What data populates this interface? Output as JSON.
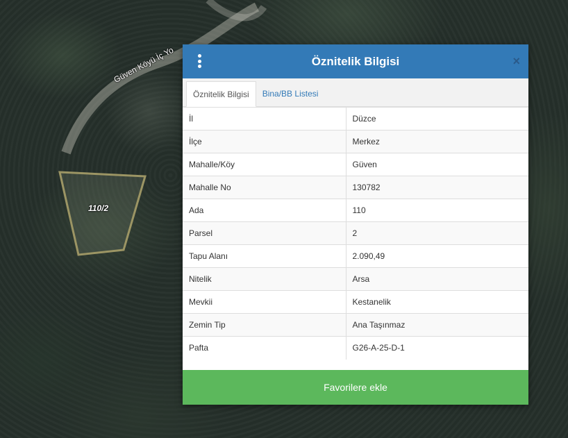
{
  "map": {
    "road_label": "Güven Köyü İç Yo",
    "parcel_label": "110/2"
  },
  "dialog": {
    "title": "Öznitelik Bilgisi",
    "menu_icon": "vertical-dots-icon",
    "close_label": "×",
    "tabs": [
      {
        "label": "Öznitelik Bilgisi",
        "active": true
      },
      {
        "label": "Bina/BB Listesi",
        "active": false
      }
    ],
    "rows": [
      {
        "key": "İl",
        "value": "Düzce"
      },
      {
        "key": "İlçe",
        "value": "Merkez"
      },
      {
        "key": "Mahalle/Köy",
        "value": "Güven"
      },
      {
        "key": "Mahalle No",
        "value": "130782"
      },
      {
        "key": "Ada",
        "value": "110"
      },
      {
        "key": "Parsel",
        "value": "2"
      },
      {
        "key": "Tapu Alanı",
        "value": "2.090,49"
      },
      {
        "key": "Nitelik",
        "value": "Arsa"
      },
      {
        "key": "Mevkii",
        "value": "Kestanelik"
      },
      {
        "key": "Zemin Tip",
        "value": "Ana Taşınmaz"
      },
      {
        "key": "Pafta",
        "value": "G26-A-25-D-1"
      }
    ],
    "favorite_button": "Favorilere ekle"
  },
  "colors": {
    "header": "#337ab7",
    "favorite": "#5cb85c",
    "parcel_outline": "#9c9564"
  }
}
